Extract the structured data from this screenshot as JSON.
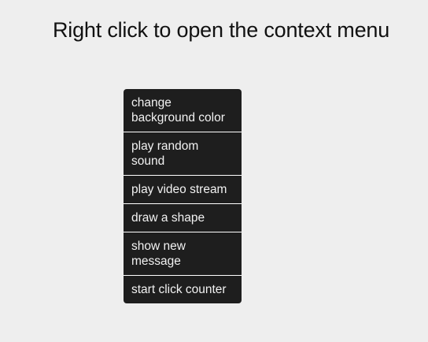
{
  "page": {
    "title": "Right click to open the context menu"
  },
  "context_menu": {
    "items": [
      {
        "label": "change background color"
      },
      {
        "label": "play random sound"
      },
      {
        "label": "play video stream"
      },
      {
        "label": "draw a shape"
      },
      {
        "label": "show new message"
      },
      {
        "label": "start click counter"
      }
    ]
  },
  "colors": {
    "background": "#eeeeee",
    "menu_background": "#1e1e1e",
    "menu_text": "#f2f2f2",
    "menu_divider": "#ffffff",
    "title_text": "#111111"
  }
}
